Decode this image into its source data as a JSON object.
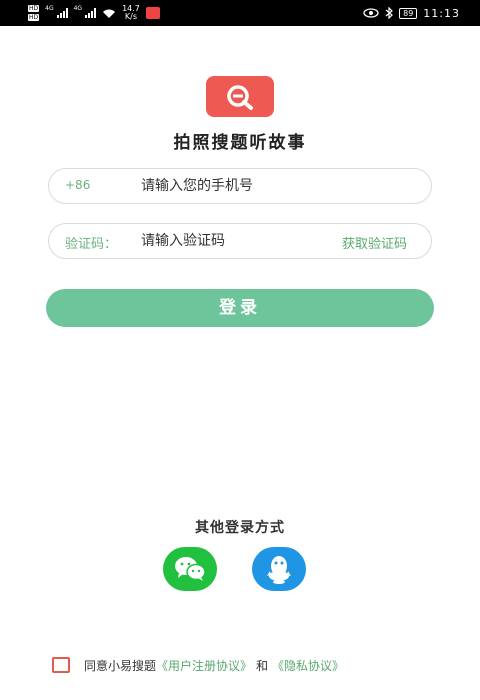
{
  "status_bar": {
    "hd_top": "HD",
    "hd_bottom": "HD",
    "net1": "4G",
    "net2": "4G",
    "speed_value": "14.7",
    "speed_unit": "K/s",
    "battery": "89",
    "time": "11:13"
  },
  "app": {
    "title": "拍照搜题听故事",
    "brand_color": "#ee5a52",
    "accent_color": "#6ec59c"
  },
  "phone_field": {
    "prefix": "+86",
    "placeholder": "请输入您的手机号"
  },
  "code_field": {
    "label": "验证码：",
    "placeholder": "请输入验证码",
    "get_code_label": "获取验证码"
  },
  "login_button": {
    "label": "登录"
  },
  "other_login": {
    "title": "其他登录方式",
    "options": [
      {
        "name": "wechat",
        "icon": "wechat-icon",
        "color": "#21c03e"
      },
      {
        "name": "qq",
        "icon": "qq-icon",
        "color": "#1f95e3"
      }
    ]
  },
  "agreement": {
    "prefix_text": "同意小易搜题",
    "user_agreement": "《用户注册协议》",
    "joiner": "和",
    "privacy_agreement": "《隐私协议》"
  }
}
